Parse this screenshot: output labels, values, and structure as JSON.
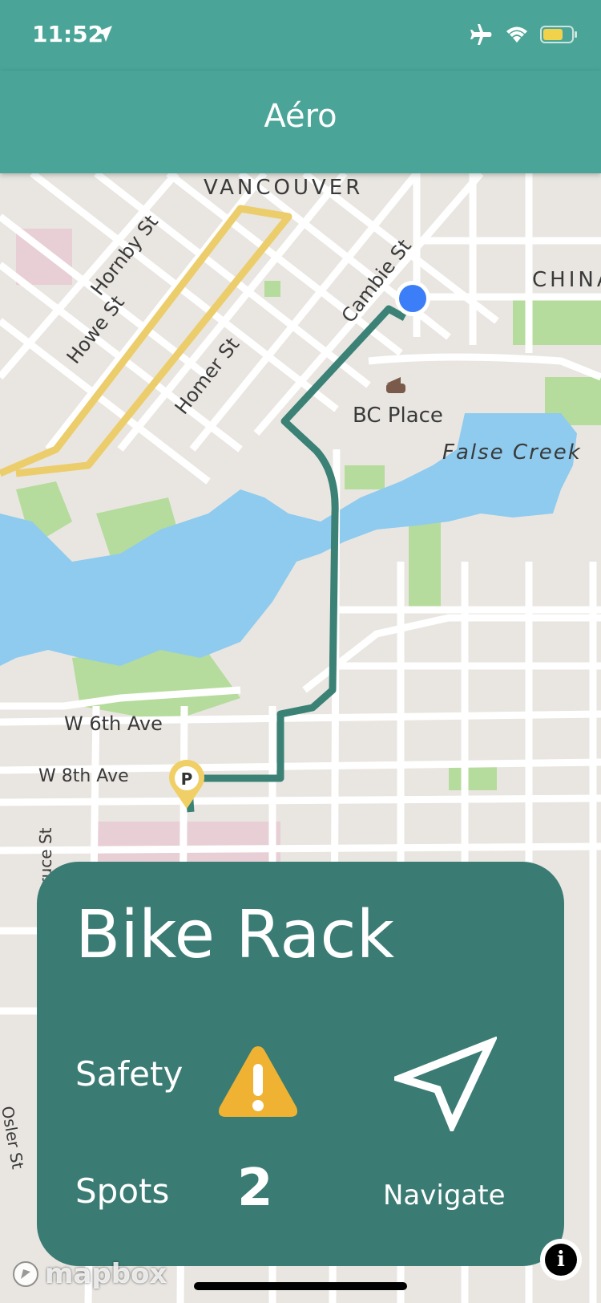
{
  "status": {
    "time": "11:52"
  },
  "nav": {
    "title": "Aéro"
  },
  "map": {
    "labels": {
      "vancouver": "VANCOUVER",
      "china": "CHINA",
      "hornby": "Hornby St",
      "howe": "Howe St",
      "homer": "Homer St",
      "cambie": "Cambie St",
      "bc_place": "BC Place",
      "false_creek": "False Creek",
      "w6th": "W 6th Ave",
      "w8th": "W 8th Ave",
      "spruce": "Spruce St",
      "osler": "Osler St",
      "parking_marker": "P"
    },
    "colors": {
      "water": "#8ecbee",
      "park": "#b5dc9c",
      "route": "#3b8175",
      "highway": "#eccd6c",
      "location": "#3b7ef7"
    }
  },
  "card": {
    "title": "Bike Rack",
    "safety_label": "Safety",
    "spots_label": "Spots",
    "spots_value": "2",
    "navigate_label": "Navigate",
    "warning_color": "#f0b233"
  },
  "attribution": {
    "logo": "mapbox",
    "info_icon": "i"
  }
}
